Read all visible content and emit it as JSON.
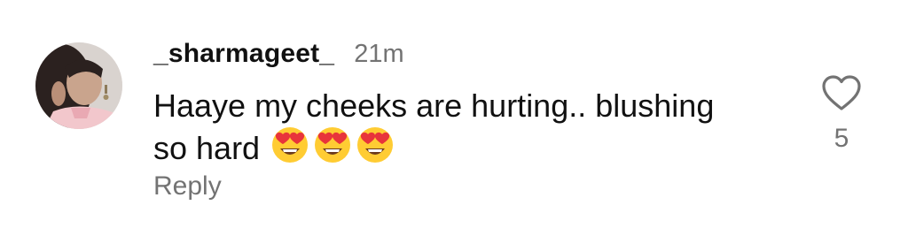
{
  "comment": {
    "username": "_sharmageet_",
    "time": "21m",
    "text_line1": "Haaye my cheeks are hurting.. blushing",
    "text_line2": "so hard",
    "emojis": [
      "heart-eyes-emoji",
      "heart-eyes-emoji",
      "heart-eyes-emoji"
    ],
    "reply_label": "Reply",
    "like_count": "5"
  },
  "colors": {
    "primary_text": "#111111",
    "secondary_text": "#737373",
    "emoji_face": "#ffcc33",
    "emoji_heart": "#e8343b"
  },
  "icons": {
    "like": "heart-outline-icon"
  }
}
